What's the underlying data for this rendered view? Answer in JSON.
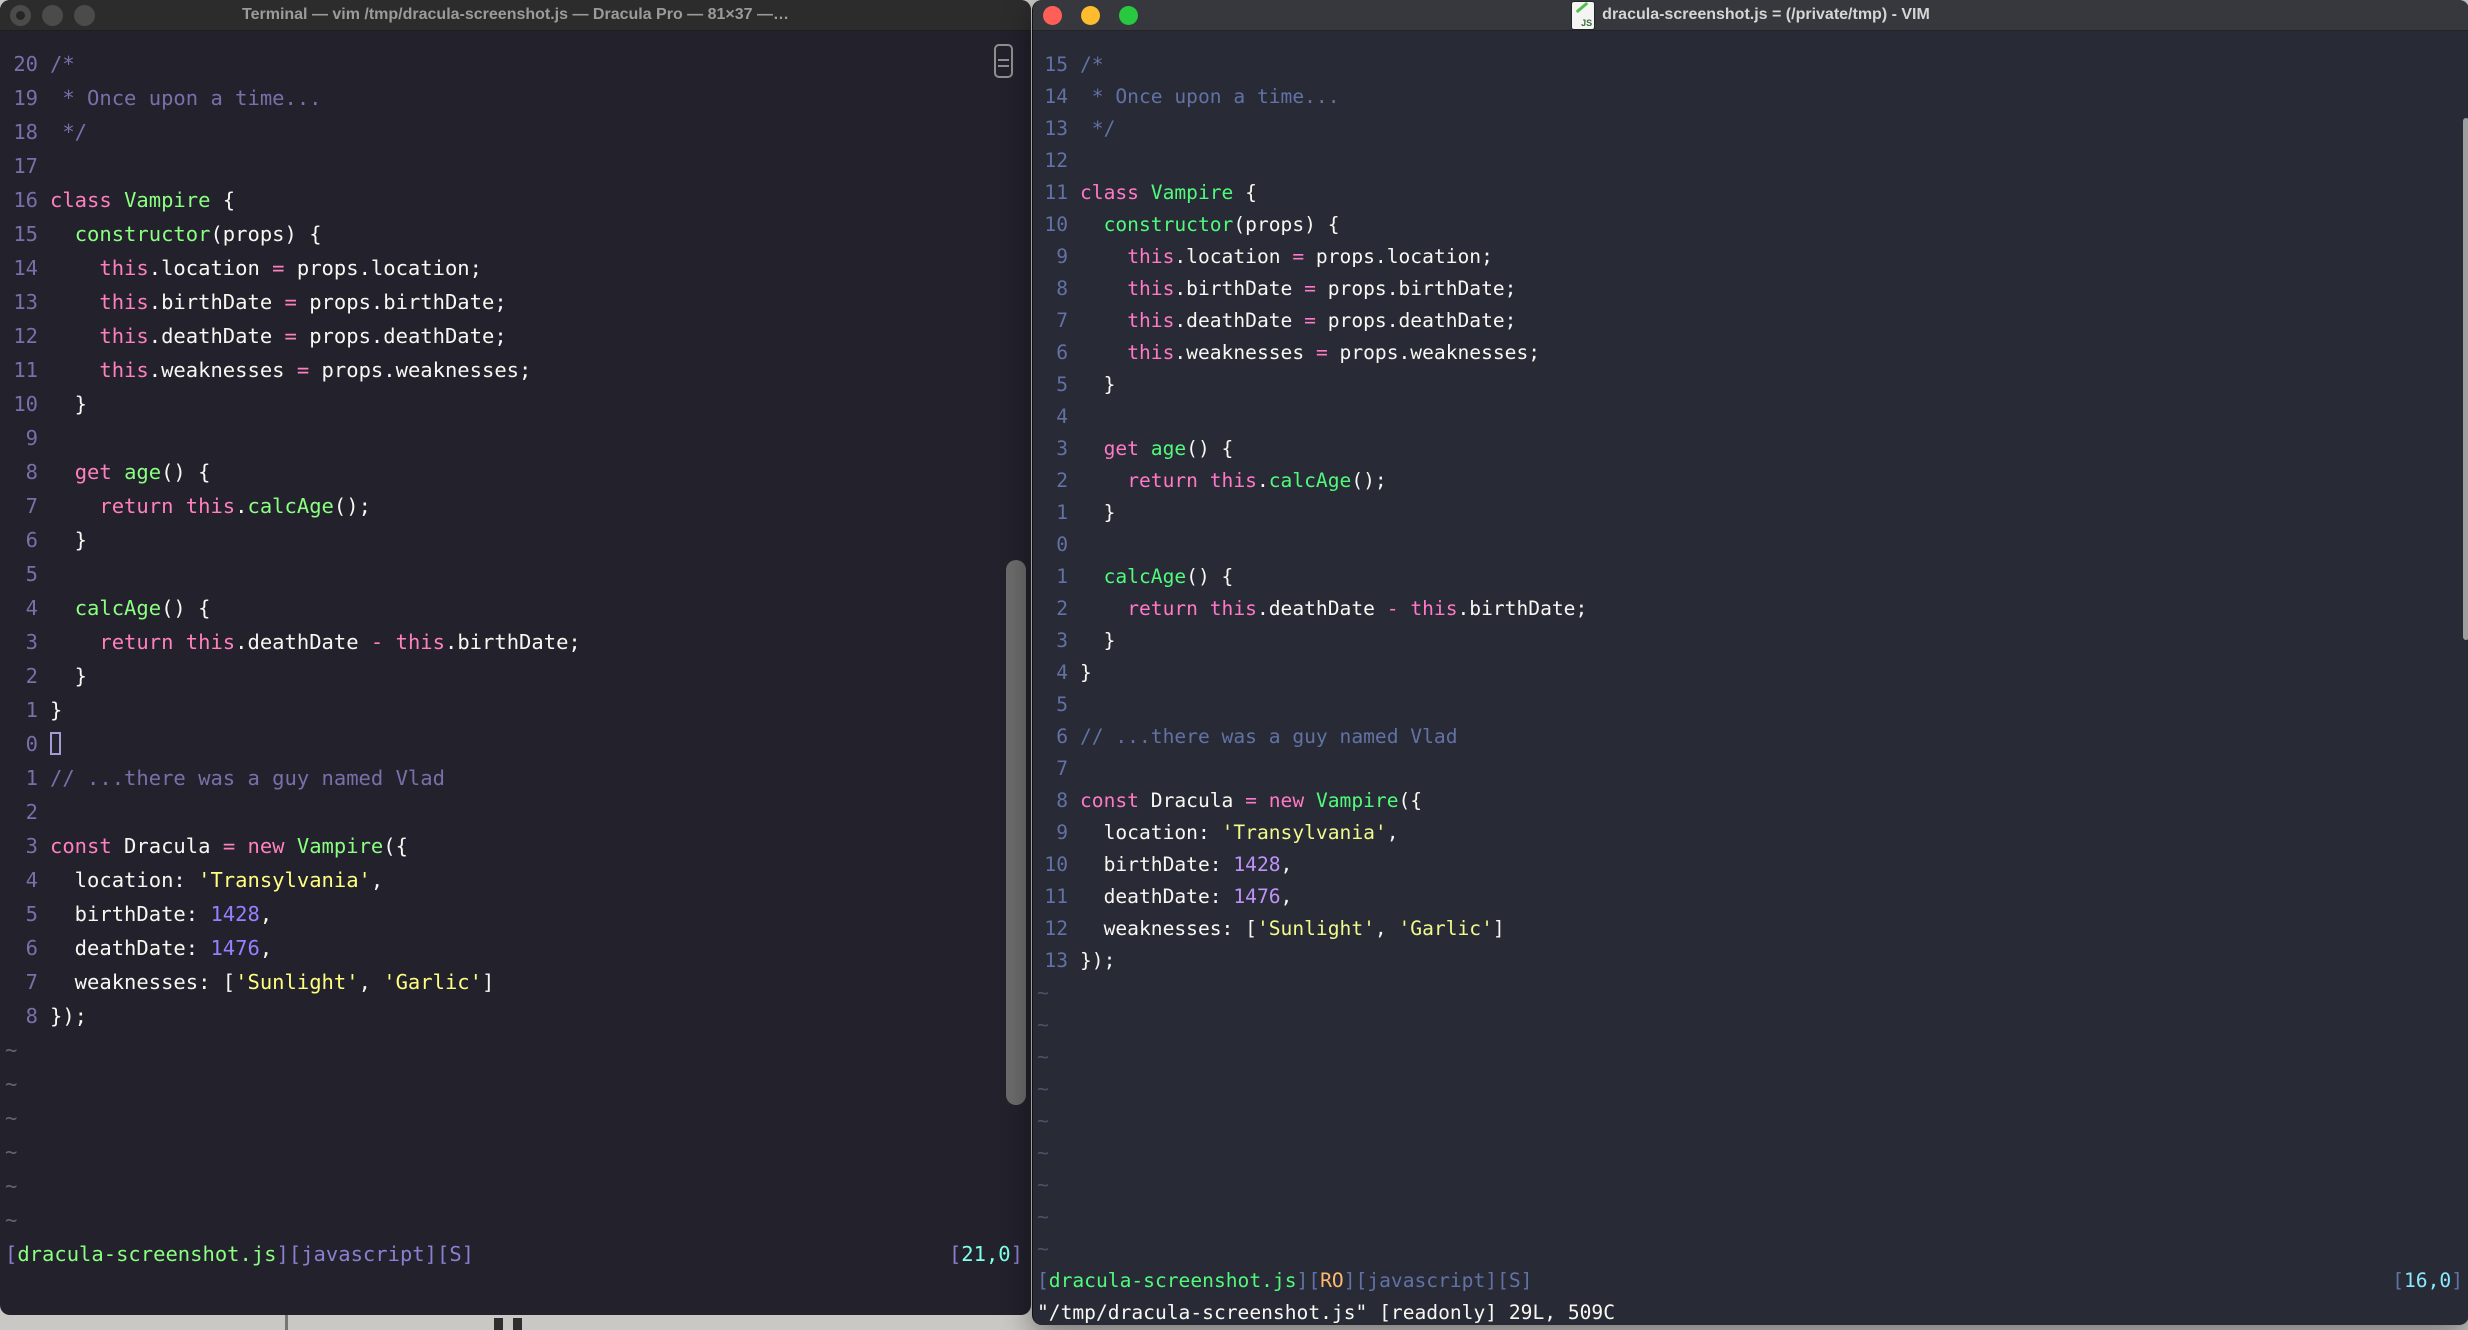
{
  "desktop": {
    "background_color": "#C9C8C5"
  },
  "tilde_char": "~",
  "code_lines": [
    [
      [
        "c",
        "/*"
      ]
    ],
    [
      [
        "c",
        " * Once upon a time..."
      ]
    ],
    [
      [
        "c",
        " */"
      ]
    ],
    [],
    [
      [
        "p",
        "class"
      ],
      [
        "f",
        " "
      ],
      [
        "g",
        "Vampire"
      ],
      [
        "f",
        " {"
      ]
    ],
    [
      [
        "f",
        "  "
      ],
      [
        "g",
        "constructor"
      ],
      [
        "f",
        "(props) {"
      ]
    ],
    [
      [
        "f",
        "    "
      ],
      [
        "p",
        "this"
      ],
      [
        "f",
        ".location "
      ],
      [
        "p",
        "="
      ],
      [
        "f",
        " props.location;"
      ]
    ],
    [
      [
        "f",
        "    "
      ],
      [
        "p",
        "this"
      ],
      [
        "f",
        ".birthDate "
      ],
      [
        "p",
        "="
      ],
      [
        "f",
        " props.birthDate;"
      ]
    ],
    [
      [
        "f",
        "    "
      ],
      [
        "p",
        "this"
      ],
      [
        "f",
        ".deathDate "
      ],
      [
        "p",
        "="
      ],
      [
        "f",
        " props.deathDate;"
      ]
    ],
    [
      [
        "f",
        "    "
      ],
      [
        "p",
        "this"
      ],
      [
        "f",
        ".weaknesses "
      ],
      [
        "p",
        "="
      ],
      [
        "f",
        " props.weaknesses;"
      ]
    ],
    [
      [
        "f",
        "  }"
      ]
    ],
    [],
    [
      [
        "f",
        "  "
      ],
      [
        "p",
        "get"
      ],
      [
        "f",
        " "
      ],
      [
        "g",
        "age"
      ],
      [
        "f",
        "() {"
      ]
    ],
    [
      [
        "f",
        "    "
      ],
      [
        "p",
        "return"
      ],
      [
        "f",
        " "
      ],
      [
        "p",
        "this"
      ],
      [
        "f",
        "."
      ],
      [
        "g",
        "calcAge"
      ],
      [
        "f",
        "();"
      ]
    ],
    [
      [
        "f",
        "  }"
      ]
    ],
    [],
    [
      [
        "f",
        "  "
      ],
      [
        "g",
        "calcAge"
      ],
      [
        "f",
        "() {"
      ]
    ],
    [
      [
        "f",
        "    "
      ],
      [
        "p",
        "return"
      ],
      [
        "f",
        " "
      ],
      [
        "p",
        "this"
      ],
      [
        "f",
        ".deathDate "
      ],
      [
        "p",
        "-"
      ],
      [
        "f",
        " "
      ],
      [
        "p",
        "this"
      ],
      [
        "f",
        ".birthDate;"
      ]
    ],
    [
      [
        "f",
        "  }"
      ]
    ],
    [
      [
        "f",
        "}"
      ]
    ],
    [],
    [
      [
        "c",
        "// ...there was a guy named Vlad"
      ]
    ],
    [],
    [
      [
        "p",
        "const"
      ],
      [
        "f",
        " Dracula "
      ],
      [
        "p",
        "="
      ],
      [
        "f",
        " "
      ],
      [
        "p",
        "new"
      ],
      [
        "f",
        " "
      ],
      [
        "g",
        "Vampire"
      ],
      [
        "f",
        "({"
      ]
    ],
    [
      [
        "f",
        "  location: "
      ],
      [
        "y",
        "'Transylvania'"
      ],
      [
        "f",
        ","
      ]
    ],
    [
      [
        "f",
        "  birthDate: "
      ],
      [
        "n",
        "1428"
      ],
      [
        "f",
        ","
      ]
    ],
    [
      [
        "f",
        "  deathDate: "
      ],
      [
        "n",
        "1476"
      ],
      [
        "f",
        ","
      ]
    ],
    [
      [
        "f",
        "  weaknesses: ["
      ],
      [
        "y",
        "'Sunlight'"
      ],
      [
        "f",
        ", "
      ],
      [
        "y",
        "'Garlic'"
      ],
      [
        "f",
        "]"
      ]
    ],
    [
      [
        "f",
        "});"
      ]
    ]
  ],
  "left_window": {
    "app": "Terminal",
    "title": "Terminal — vim /tmp/dracula-screenshot.js — Dracula Pro — 81×37 —…",
    "theme_name": "Dracula Pro",
    "traffic_lights": [
      "#4B4B4B",
      "#4B4B4B",
      "#4B4B4B"
    ],
    "gutter": [
      "20",
      "19",
      "18",
      "17",
      "16",
      "15",
      "14",
      "13",
      "12",
      "11",
      "10",
      "9",
      "8",
      "7",
      "6",
      "5",
      "4",
      "3",
      "2",
      "1",
      "0",
      "1",
      "2",
      "3",
      "4",
      "5",
      "6",
      "7",
      "8"
    ],
    "cursor_line_index": 20,
    "cursor_style": "hollow",
    "tilde_count": 6,
    "status_left": [
      [
        "b",
        "["
      ],
      [
        "g",
        "dracula-screenshot.js"
      ],
      [
        "b",
        "]["
      ],
      [
        "b",
        "javascript"
      ],
      [
        "b",
        "]["
      ],
      [
        "b",
        "S"
      ],
      [
        "b",
        "]"
      ]
    ],
    "status_right": [
      [
        "b",
        "["
      ],
      [
        "cy",
        "21,0"
      ],
      [
        "b",
        "]"
      ]
    ],
    "command_line": "",
    "colors": {
      "bg": "#22212C",
      "fg": "#F8F8F2",
      "pink": "#FF80BF",
      "green": "#8AFF80",
      "yellow": "#FFFF80",
      "num": "#9580FF",
      "cyan": "#80FFEA",
      "comment": "#7970A9",
      "linenr": "#7970A9",
      "tilde": "#66646F",
      "bracket": "#8A80CF",
      "cursor": "#A49BD6"
    }
  },
  "right_window": {
    "app": "VIM",
    "title": "dracula-screenshot.js = (/private/tmp) - VIM",
    "doc_icon_label": "JS",
    "traffic_lights": [
      "#FF5F57",
      "#FEBC2E",
      "#28C840"
    ],
    "gutter": [
      "15",
      "14",
      "13",
      "12",
      "11",
      "10",
      "9",
      "8",
      "7",
      "6",
      "5",
      "4",
      "3",
      "2",
      "1",
      "0",
      "1",
      "2",
      "3",
      "4",
      "5",
      "6",
      "7",
      "8",
      "9",
      "10",
      "11",
      "12",
      "13"
    ],
    "cursor_line_index": 15,
    "cursor_style": "none",
    "tilde_count": 9,
    "status_left": [
      [
        "b",
        "["
      ],
      [
        "g",
        "dracula-screenshot.js"
      ],
      [
        "b",
        "]["
      ],
      [
        "o",
        "RO"
      ],
      [
        "b",
        "]["
      ],
      [
        "b",
        "javascript"
      ],
      [
        "b",
        "]["
      ],
      [
        "b",
        "S"
      ],
      [
        "b",
        "]"
      ]
    ],
    "status_right": [
      [
        "b",
        "["
      ],
      [
        "cy",
        "16,0"
      ],
      [
        "b",
        "]"
      ]
    ],
    "command_line": "\"/tmp/dracula-screenshot.js\" [readonly] 29L, 509C",
    "colors": {
      "bg": "#282A36",
      "fg": "#F8F8F2",
      "pink": "#FF79C6",
      "green": "#50FA7B",
      "yellow": "#F1FA8C",
      "num": "#BD93F9",
      "cyan": "#8BE9FD",
      "comment": "#6272A4",
      "linenr": "#6272A4",
      "tilde": "#4D5268",
      "bracket": "#6272A4",
      "orange": "#FFB86C"
    }
  }
}
